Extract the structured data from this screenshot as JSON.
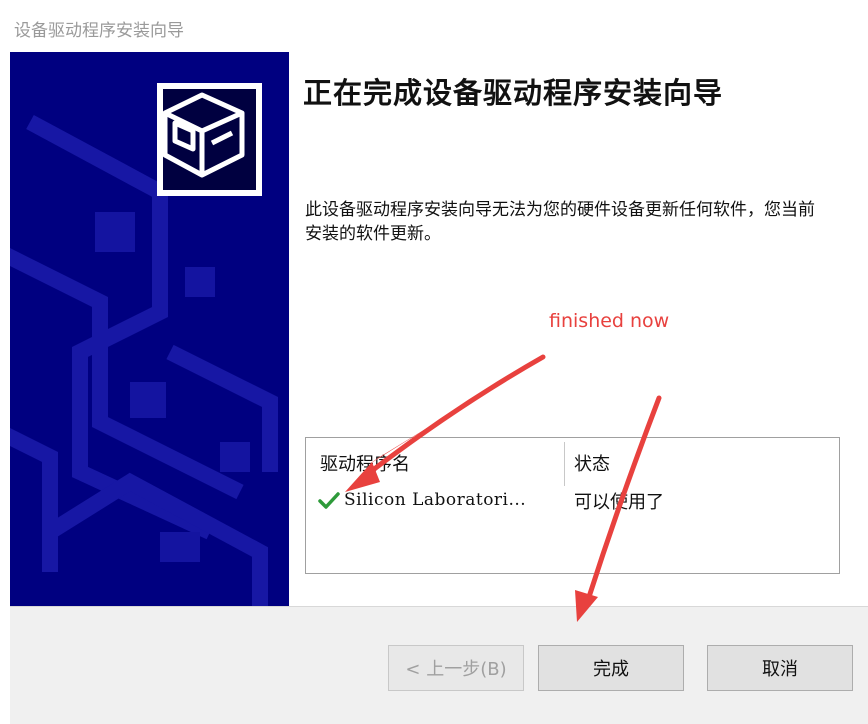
{
  "window": {
    "title": "设备驱动程序安装向导"
  },
  "main": {
    "heading": "正在完成设备驱动程序安装向导",
    "description": "此设备驱动程序安装向导无法为您的硬件设备更新任何软件，您当前安装的软件更新。"
  },
  "annotation": {
    "text": "finished now",
    "color": "#e8413e"
  },
  "driver_table": {
    "columns": [
      "驱动程序名",
      "状态"
    ],
    "rows": [
      {
        "icon": "check-icon",
        "name": "Silicon Laboratori...",
        "status": "可以使用了"
      }
    ]
  },
  "buttons": {
    "back": "< 上一步(B)",
    "finish": "完成",
    "cancel": "取消"
  },
  "colors": {
    "side_panel": "#000080",
    "check": "#2e9a3a"
  }
}
